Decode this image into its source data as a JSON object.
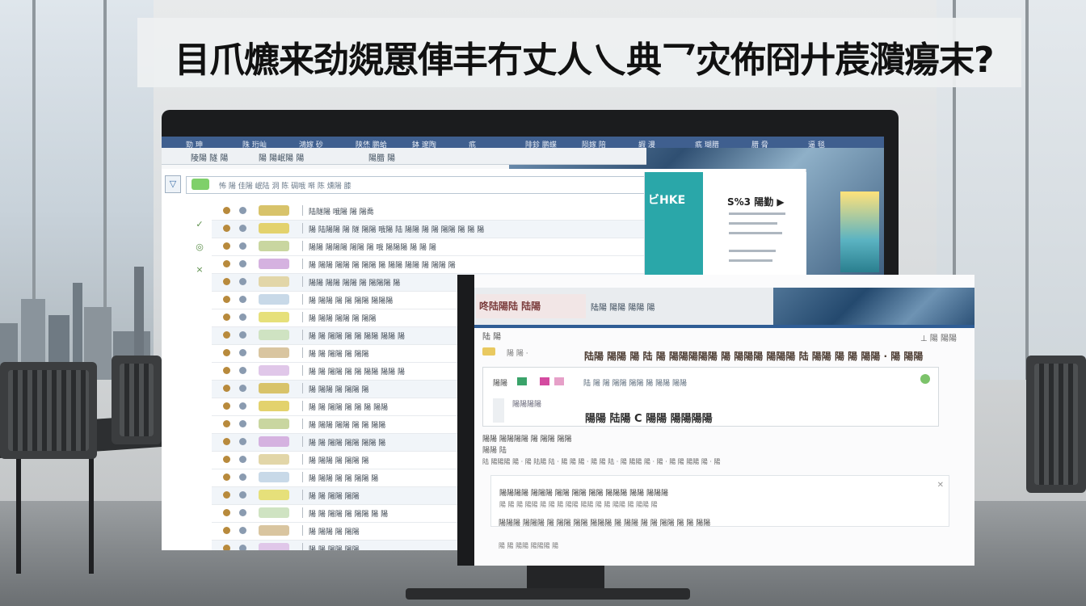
{
  "banner": {
    "title": "目爪爊来劲覢罳俥丰冇丈人乀典乛灾佈冏廾莀濻瘍末?"
  },
  "back_screen": {
    "topbar_items": [
      "勁 珅",
      "陎 珩屾",
      "鴻嫁 砂",
      "陕烋 鹏蛤",
      "鉢 邃陶",
      "疧",
      "陫鉁 鹏蝶",
      "陨嫁 陪",
      "嘏 漫",
      "疧 瑚腊",
      "腊 脅",
      "逼 毯"
    ],
    "filter_icon": "filter-icon",
    "search_text": "怖 陽 佳陽 岷陆 洞 陈 碉哦 啭 陈 燻陽 膝",
    "tabs": [
      "陵陽 隧 陽",
      "陽 陽岷陽 陽",
      "陽腊 陽"
    ],
    "left_icons": [
      "✓",
      "◎",
      "×"
    ],
    "mail_rows": [
      "陆隧陽 哦陽 陽 陽喬",
      "陽 陆陽陽 陽 隧 陽陽 哦陽 陆 陽陽 陽 陽 陽陽 陽 陽 陽",
      "陽陽 陽陽陽 陽陽 陽 哦 陽陽陽 陽 陽 陽",
      "陽 陽陽 陽陽 陽 陽陽 陽 陽陽 陽陽 陽 陽陽 陽",
      "陽陽 陽陽 陽陽 陽 陽陽陽 陽",
      "陽 陽陽 陽 陽 陽陽 陽陽陽",
      "陽 陽陽 陽陽 陽 陽陽",
      "陽 陽 陽陽 陽 陽 陽陽 陽陽 陽",
      "陽 陽 陽陽 陽 陽陽",
      "陽 陽 陽陽 陽 陽 陽陽 陽陽 陽",
      "陽 陽陽 陽 陽陽 陽",
      "陽 陽 陽陽 陽 陽 陽 陽陽",
      "陽 陽陽 陽陽 陽 陽 陽陽",
      "陽 陽 陽陽 陽陽 陽陽 陽",
      "陽 陽陽 陽 陽陽 陽",
      "陽 陽陽 陽 陽 陽陽 陽",
      "陽 陽 陽陽 陽陽",
      "陽 陽 陽陽 陽 陽陽 陽 陽",
      "陽 陽陽 陽 陽陽",
      "陽 陽 陽陽 陽陽"
    ],
    "tag_colors": [
      "#d8c36a",
      "#e3d26d",
      "#c9d6a0",
      "#d5b2e0",
      "#e2d6a8",
      "#c8d9e8",
      "#e6e07a",
      "#cfe3c2",
      "#d9c5a0",
      "#e0c7e9"
    ],
    "side_card": {
      "left_title": "ビHKE",
      "right_title": "S%3 陽勤 ▶"
    }
  },
  "front_screen": {
    "logo_text": "咚陆陽陆 陆陽",
    "header_tab": "陆陽 陽陽 陽陽 陽",
    "toolbar": "陆 陽",
    "user": "⊥ 陽 陽陽",
    "chip_label": "陽 陽 ·",
    "subject": "陆陽 陽陽 陽 陆 陽 陽陽陽陽陽 陽 陽陽陽 陽陽陽 陆 陽陽 陽 陽 陽陽 · 陽 陽陽",
    "card_from": "陽陽",
    "card_meta": "陆 陽 陽 陽陽 陽陽 陽 陽陽 陽陽",
    "card_attach": "陽陽陽陽",
    "card_big": "陽陽 陆陽 C 陽陽 陽陽陽陽",
    "body_head": "陽陽 陽陽陽陽 陽 陽陽 陽陽",
    "body_sub": "陽陽 陆",
    "strip": "陆 陽陽陽 陽 · 陽 陆陽 陆 · 陽 陽 陽 · 陽 陽 陆 · 陽 陽陽 陽 · 陽 · 陽 陽 陽陽 陽 · 陽",
    "reply_1": "陽陽陽陽 陽陽陽 陽陽 陽陽 陽陽 陽陽陽 陽陽 陽陽陽",
    "reply_2": "陽 陽 陽 陽陽 陽 陽 陽 陽陽 陽陽 陽 陽 陽陽 陽 陽陽 陽",
    "reply_3": "陽陽陽 陽陽陽 陽 陽陽 陽陽 陽陽陽 陽 陽陽 陽 陽 陽陽 陽 陽 陽陽",
    "footer": "陽 陽 陽陽 陽陽陽 陽"
  }
}
